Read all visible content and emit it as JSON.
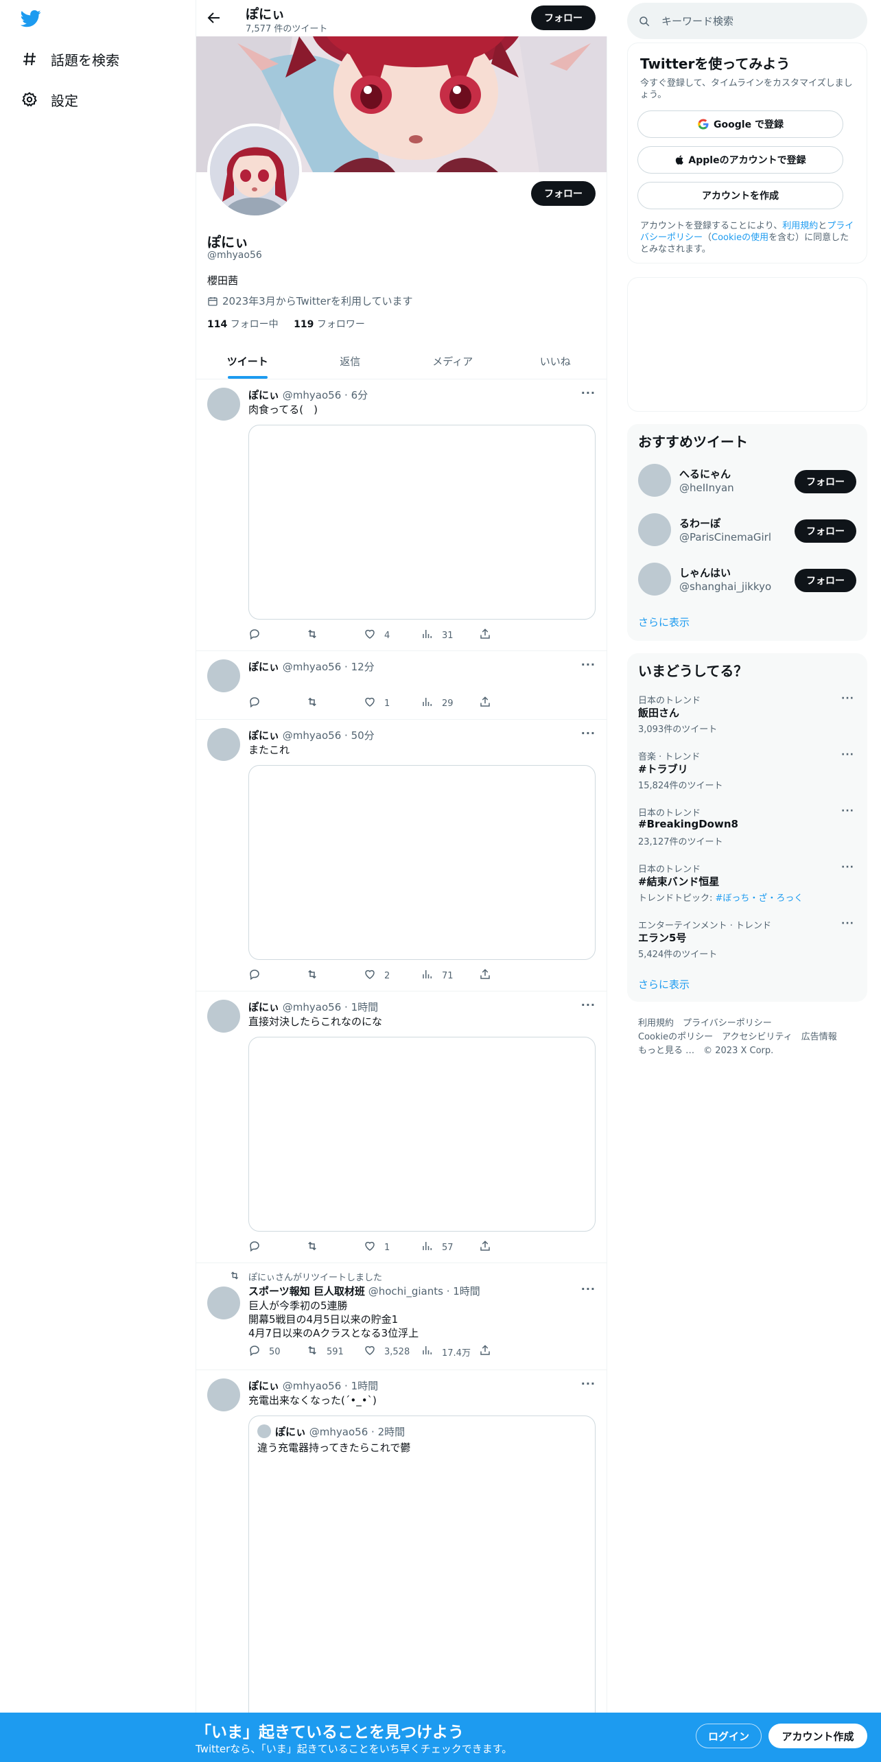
{
  "nav": {
    "explore_label": "話題を検索",
    "settings_label": "設定"
  },
  "header": {
    "name": "ぽにぃ",
    "tweet_count": "7,577 件のツイート",
    "follow_label": "フォロー"
  },
  "profile": {
    "name": "ぽにぃ",
    "handle": "@mhyao56",
    "bio": "櫻田茜",
    "joined": "2023年3月からTwitterを利用しています",
    "following_count": "114",
    "following_label": "フォロー中",
    "followers_count": "119",
    "followers_label": "フォロワー",
    "follow_label": "フォロー"
  },
  "tabs": [
    {
      "label": "ツイート"
    },
    {
      "label": "返信"
    },
    {
      "label": "メディア"
    },
    {
      "label": "いいね"
    }
  ],
  "tweets": [
    {
      "name": "ぽにぃ",
      "handle": "@mhyao56",
      "time": "6分",
      "text": "肉食ってる(　)",
      "replies": "",
      "retweets": "",
      "likes": "4",
      "views": "31"
    },
    {
      "name": "ぽにぃ",
      "handle": "@mhyao56",
      "time": "12分",
      "text": "",
      "replies": "",
      "retweets": "",
      "likes": "1",
      "views": "29"
    },
    {
      "name": "ぽにぃ",
      "handle": "@mhyao56",
      "time": "50分",
      "text": "またこれ",
      "replies": "",
      "retweets": "",
      "likes": "2",
      "views": "71"
    },
    {
      "name": "ぽにぃ",
      "handle": "@mhyao56",
      "time": "1時間",
      "text": "直接対決したらこれなのにな",
      "replies": "",
      "retweets": "",
      "likes": "1",
      "views": "57"
    },
    {
      "retweet_note": "ぽにぃさんがリツイートしました",
      "name": "スポーツ報知 巨人取材班",
      "handle": "@hochi_giants",
      "time": "1時間",
      "text": "巨人が今季初の5連勝\n開幕5戦目の4月5日以来の貯金1\n4月7日以来のAクラスとなる3位浮上",
      "replies": "50",
      "retweets": "591",
      "likes": "3,528",
      "views": "17.4万"
    },
    {
      "name": "ぽにぃ",
      "handle": "@mhyao56",
      "time": "1時間",
      "text": "充電出来なくなった(ˊ•_•ˋ)",
      "quote": {
        "name": "ぽにぃ",
        "handle": "@mhyao56",
        "time": "2時間",
        "text": "違う充電器持ってきたらこれで鬱"
      }
    }
  ],
  "search": {
    "placeholder": "キーワード検索"
  },
  "signup_card": {
    "title": "Twitterを使ってみよう",
    "subtitle": "今すぐ登録して、タイムラインをカスタマイズしましょう。",
    "google_label": "Google で登録",
    "apple_label": "Appleのアカウントで登録",
    "create_label": "アカウントを作成",
    "legal_1": "アカウントを登録することにより、",
    "legal_terms": "利用規約",
    "legal_2": "と",
    "legal_privacy": "プライバシーポリシー",
    "legal_3": "（",
    "legal_cookie": "Cookieの使用",
    "legal_4": "を含む）に同意したとみなされます。"
  },
  "recommended": {
    "title": "おすすめツイート",
    "users": [
      {
        "name": "へるにゃん",
        "handle": "@heIInyan"
      },
      {
        "name": "るわーぽ",
        "handle": "@ParisCinemaGirl"
      },
      {
        "name": "しゃんはい",
        "handle": "@shanghai_jikkyo"
      }
    ],
    "follow_label": "フォロー",
    "show_more": "さらに表示"
  },
  "trends": {
    "title": "いまどうしてる？",
    "items": [
      {
        "meta": "日本のトレンド",
        "name": "飯田さん",
        "count": "3,093件のツイート"
      },
      {
        "meta": "音楽 · トレンド",
        "name": "#トラブリ",
        "count": "15,824件のツイート"
      },
      {
        "meta": "日本のトレンド",
        "name": "#BreakingDown8",
        "count": "23,127件のツイート"
      },
      {
        "meta": "日本のトレンド",
        "name": "#結束バンド恒星",
        "count_prefix": "トレンドトピック: ",
        "count_link": "#ぼっち・ざ・ろっく"
      },
      {
        "meta": "エンターテインメント · トレンド",
        "name": "エラン5号",
        "count": "5,424件のツイート"
      }
    ],
    "show_more": "さらに表示"
  },
  "footer": {
    "line1": "利用規約　プライバシーポリシー",
    "line2": "Cookieのポリシー　アクセシビリティ　広告情報",
    "line3": "もっと見る …　© 2023 X Corp."
  },
  "bottom_bar": {
    "title": "「いま」起きていることを見つけよう",
    "subtitle": "Twitterなら、「いま」起きていることをいち早くチェックできます。",
    "login_label": "ログイン",
    "signup_label": "アカウント作成"
  },
  "colors": {
    "accent": "#1d9bf0",
    "text": "#0f1419",
    "muted": "#536471",
    "border": "#eff3f4"
  }
}
